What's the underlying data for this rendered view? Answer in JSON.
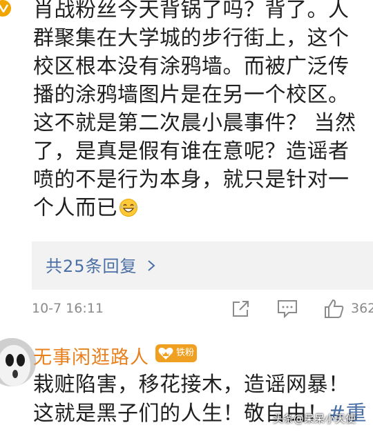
{
  "comment": {
    "body_text": "肖战粉丝今天背锅了吗？背了。人\n群聚集在大学城的步行街上，这个\n校区根本没有涂鸦墙。而被广泛传\n播的涂鸦墙图片是在另一个校区。\n这不就是第二次晨小晨事件？  当然\n了，是真是假有谁在意呢？造谣者\n喷的不是行为本身，就只是针对一\n个人而已",
    "emoji_icon": "grinning-sweat-emoji",
    "replies_link": "共25条回复",
    "timestamp": "10-7 16:11",
    "like_count": "362",
    "verified_color": "#f2a400"
  },
  "next_comment": {
    "username": "无事闲逛路人",
    "fan_badge": "铁粉",
    "body_text": "栽赃陷害，移花接木，造谣网暴！\n这就是黑子们的人生！敬自由！",
    "hashtag": "#重",
    "username_color": "#e8801e"
  },
  "watermark": "头条@呆呆小天使",
  "colors": {
    "link": "#4a6fa5",
    "meta": "#8a8a8a",
    "reply_box_bg": "#f2f2f2",
    "badge": "#f0a020"
  }
}
